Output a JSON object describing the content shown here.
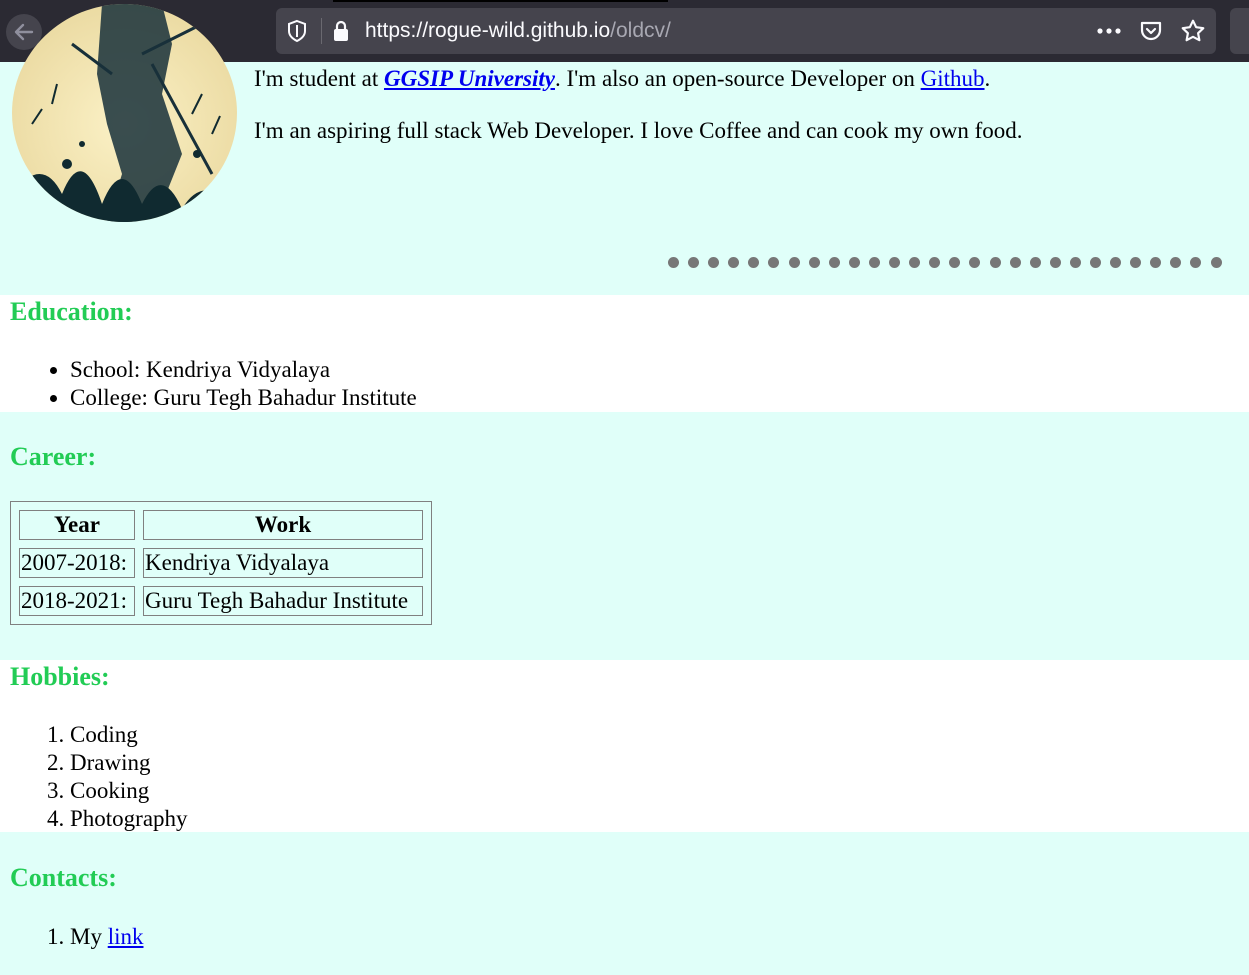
{
  "browser": {
    "url_host": "https://rogue-wild.github.io",
    "url_path": "/oldcv/",
    "buttons": [
      "back-icon",
      "forward-icon",
      "reload-icon",
      "home-icon",
      "more-icon",
      "pocket-icon",
      "star-icon"
    ]
  },
  "intro": {
    "line1_prefix": "I'm student at ",
    "university": "GGSIP University",
    "line1_middle": ". I'm also an open-source Developer on ",
    "github_link": "Github",
    "line1_suffix": ".",
    "line2": "I'm an aspiring full stack Web Developer. I love Coffee and can cook my own food.",
    "dots_count": 28
  },
  "education": {
    "heading": "Education:",
    "items": [
      "School: Kendriya Vidyalaya",
      "College: Guru Tegh Bahadur Institute"
    ]
  },
  "career": {
    "heading": "Career:",
    "columns": [
      "Year",
      "Work"
    ],
    "rows": [
      [
        "2007-2018:",
        "Kendriya Vidyalaya"
      ],
      [
        "2018-2021:",
        "Guru Tegh Bahadur Institute"
      ]
    ]
  },
  "hobbies": {
    "heading": "Hobbies:",
    "items": [
      "Coding",
      "Drawing",
      "Cooking",
      "Photography"
    ]
  },
  "contacts": {
    "heading": "Contacts:",
    "item_prefix": "My ",
    "item_link": "link"
  },
  "colors": {
    "heading": "#22cc55",
    "band": "#e0fff9",
    "link": "#0000ee"
  }
}
